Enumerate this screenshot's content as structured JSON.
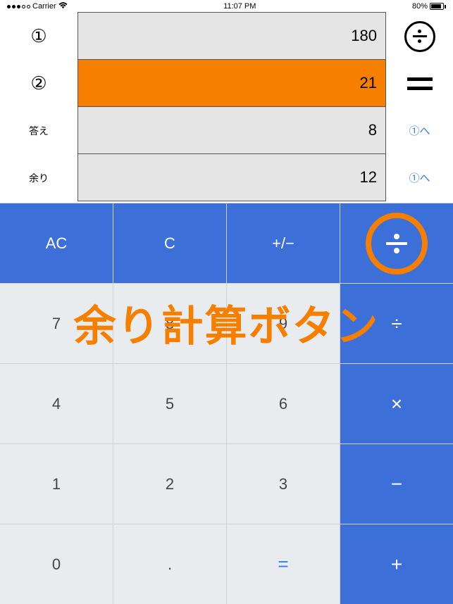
{
  "status": {
    "carrier": "Carrier",
    "time": "11:07 PM",
    "battery": "80%"
  },
  "display": {
    "rows": [
      {
        "label": "①",
        "value": "180",
        "action_type": "divide-icon"
      },
      {
        "label": "②",
        "value": "21",
        "action_type": "equals-icon",
        "active": true
      },
      {
        "label": "答え",
        "value": "8",
        "action": "①へ"
      },
      {
        "label": "余り",
        "value": "12",
        "action": "①へ"
      }
    ]
  },
  "keypad": {
    "row1": {
      "ac": "AC",
      "c": "C",
      "pm": "+/−",
      "div_mod": "÷"
    },
    "row2": {
      "k7": "7",
      "k8": "8",
      "k9": "9",
      "div": "÷"
    },
    "row3": {
      "k4": "4",
      "k5": "5",
      "k6": "6",
      "mul": "×"
    },
    "row4": {
      "k1": "1",
      "k2": "2",
      "k3": "3",
      "sub": "−"
    },
    "row5": {
      "k0": "0",
      "dot": ".",
      "eq": "=",
      "add": "+"
    }
  },
  "overlay": "余り計算ボタン"
}
